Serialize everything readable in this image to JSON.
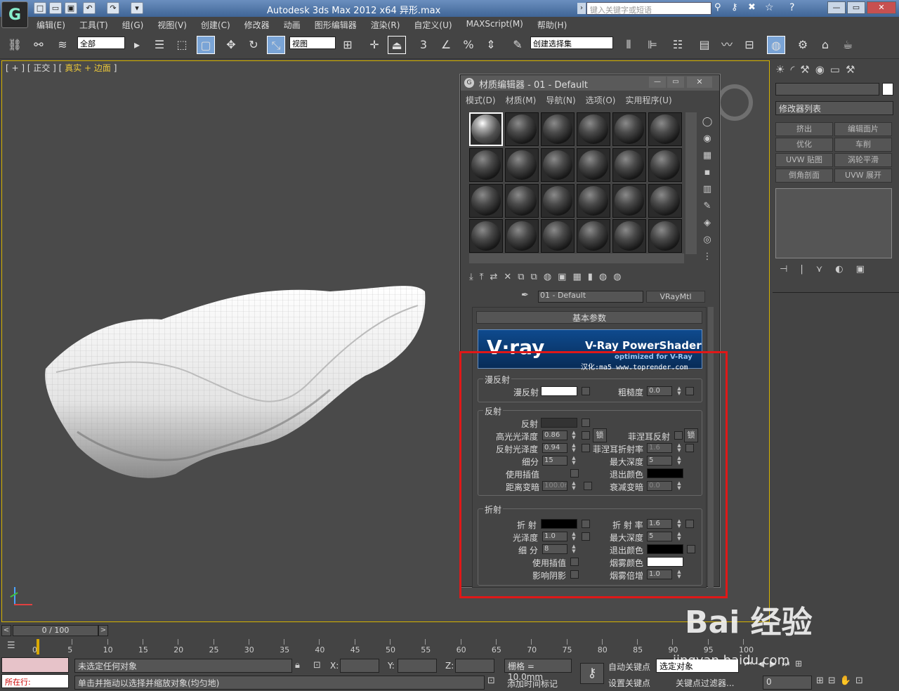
{
  "app": {
    "logo": "G",
    "title": "Autodesk 3ds Max  2012 x64    异形.max",
    "search_placeholder": "键入关键字或短语"
  },
  "menu": [
    "编辑(E)",
    "工具(T)",
    "组(G)",
    "视图(V)",
    "创建(C)",
    "修改器",
    "动画",
    "图形编辑器",
    "渲染(R)",
    "自定义(U)",
    "MAXScript(M)",
    "帮助(H)"
  ],
  "toolbar": {
    "selection_filter": "全部",
    "ref_coord": "视图",
    "named_sel": "创建选择集",
    "snap_3": "3",
    "percent": "%"
  },
  "viewport": {
    "label_pre": "[ + ] [ 正交 ] [",
    "label_shading": "真实 + 边面",
    "label_post": "]"
  },
  "command_panel": {
    "modifier_list": "修改器列表",
    "buttons": [
      "挤出",
      "编辑面片",
      "优化",
      "车削",
      "UVW 贴图",
      "涡轮平滑",
      "倒角剖面",
      "UVW 展开"
    ]
  },
  "material_editor": {
    "title": "材质编辑器 - 01 - Default",
    "menu": [
      "模式(D)",
      "材质(M)",
      "导航(N)",
      "选项(O)",
      "实用程序(U)"
    ],
    "material_name": "01 - Default",
    "material_type": "VRayMtl",
    "rollout": "基本参数",
    "banner": {
      "logo": "V·ray",
      "title": "V-Ray PowerShader",
      "sub": "optimized for V-Ray",
      "credit": "汉化:ma5 www.toprender.com"
    },
    "diffuse": {
      "group": "漫反射",
      "diffuse_label": "漫反射",
      "rough_label": "粗糙度",
      "rough": "0.0"
    },
    "reflection": {
      "group": "反射",
      "reflect_label": "反射",
      "hilight_label": "高光光泽度",
      "hilight": "0.86",
      "lock": "锁",
      "fresnel_label": "菲涅耳反射",
      "lock2": "锁",
      "refl_gloss_label": "反射光泽度",
      "refl_gloss": "0.94",
      "fresnel_ior_label": "菲涅耳折射率",
      "fresnel_ior": "1.6",
      "subdiv_label": "细分",
      "subdiv": "15",
      "maxdepth_label": "最大深度",
      "maxdepth": "5",
      "interp_label": "使用插值",
      "exit_label": "退出颜色",
      "dim_label": "距离变暗",
      "dim": "100.0m",
      "falloff_label": "衰减变暗",
      "falloff": "0.0"
    },
    "refraction": {
      "group": "折射",
      "refract_label": "折 射",
      "ior_label": "折 射 率",
      "ior": "1.6",
      "gloss_label": "光泽度",
      "gloss": "1.0",
      "maxdepth_label": "最大深度",
      "maxdepth": "5",
      "subdiv_label": "细 分",
      "subdiv": "8",
      "exit_label": "退出颜色",
      "interp_label": "使用插值",
      "fog_label": "烟雾颜色",
      "shadow_label": "影响阴影",
      "fogmult_label": "烟雾倍增",
      "fogmult": "1.0"
    }
  },
  "timeline": {
    "frame": "0 / 100",
    "ticks": [
      "0",
      "5",
      "10",
      "15",
      "20",
      "25",
      "30",
      "35",
      "40",
      "45",
      "50",
      "55",
      "60",
      "65",
      "70",
      "75",
      "80",
      "85",
      "90",
      "95",
      "100"
    ]
  },
  "status": {
    "now": "所在行:",
    "msg1": "未选定任何对象",
    "msg2": "单击并拖动以选择并缩放对象(均匀地)",
    "x": "X:",
    "y": "Y:",
    "z": "Z:",
    "grid": "栅格 = 10.0mm",
    "autokey": "自动关键点",
    "sel_obj": "选定对象",
    "setkey": "设置关键点",
    "keyfilter": "关键点过滤器...",
    "addtime": "添加时间标记",
    "frame_val": "0"
  },
  "watermark": {
    "brand": "Bai 经验",
    "url": "jingyan.baidu.com"
  },
  "colors": {
    "highlight": "#e01818",
    "viewport_border": "#d7b400"
  }
}
